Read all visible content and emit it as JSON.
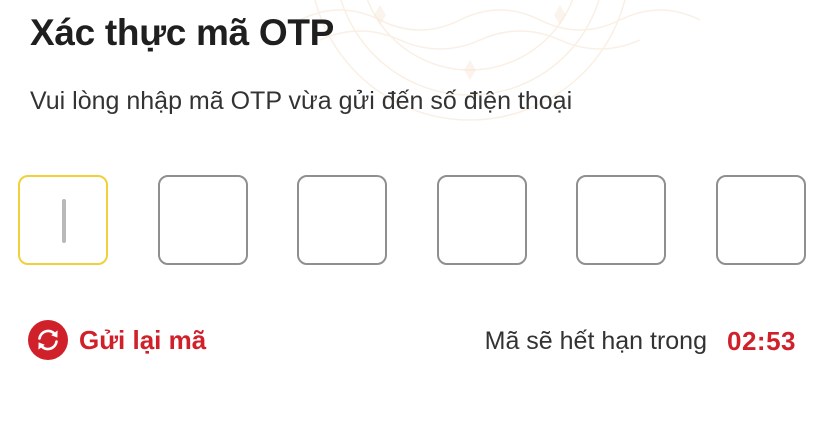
{
  "header": {
    "title": "Xác thực mã OTP",
    "instruction": "Vui lòng nhập mã OTP vừa gửi đến số điện thoại"
  },
  "otp": {
    "length": 6,
    "active_index": 0,
    "digits": [
      "",
      "",
      "",
      "",
      "",
      ""
    ]
  },
  "resend": {
    "label": "Gửi lại mã",
    "icon": "refresh-icon"
  },
  "expiry": {
    "label": "Mã sẽ hết hạn trong",
    "countdown": "02:53"
  },
  "colors": {
    "accent": "#d0202a",
    "active_border": "#f0d13a",
    "box_border": "#8f8f8f",
    "text": "#1f1f1f"
  }
}
